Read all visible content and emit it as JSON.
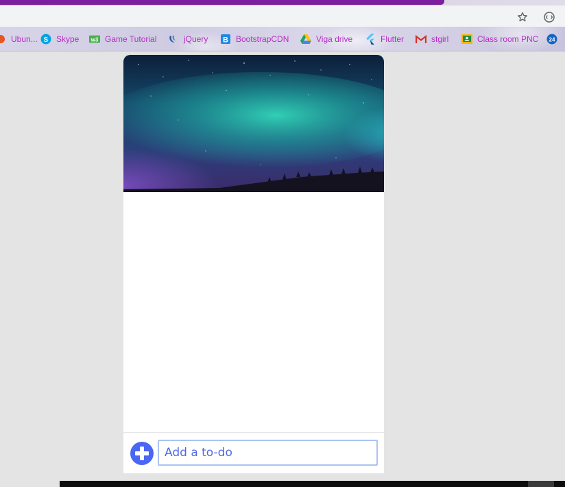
{
  "browser": {
    "accent_color": "#7c1f9e",
    "bookmark_text_color": "#b42dc4",
    "bookmarks": [
      {
        "label": "Ubun...",
        "icon": "ubuntu-icon"
      },
      {
        "label": "Skype",
        "icon": "skype-icon"
      },
      {
        "label": "Game Tutorial",
        "icon": "w3schools-icon"
      },
      {
        "label": "jQuery",
        "icon": "jquery-icon"
      },
      {
        "label": "BootstrapCDN",
        "icon": "bootstrap-icon"
      },
      {
        "label": "Viga drive",
        "icon": "google-drive-icon"
      },
      {
        "label": "Flutter",
        "icon": "flutter-icon"
      },
      {
        "label": "stgirl",
        "icon": "gmail-icon"
      },
      {
        "label": "Class room PNC",
        "icon": "google-classroom-icon"
      },
      {
        "label": "",
        "icon": "twentyfour-icon"
      }
    ]
  },
  "app": {
    "hero_image": "aurora-night-sky-image",
    "add_input": {
      "placeholder": "Add a to-do",
      "value": ""
    },
    "add_button_color": "#4a66f5"
  }
}
